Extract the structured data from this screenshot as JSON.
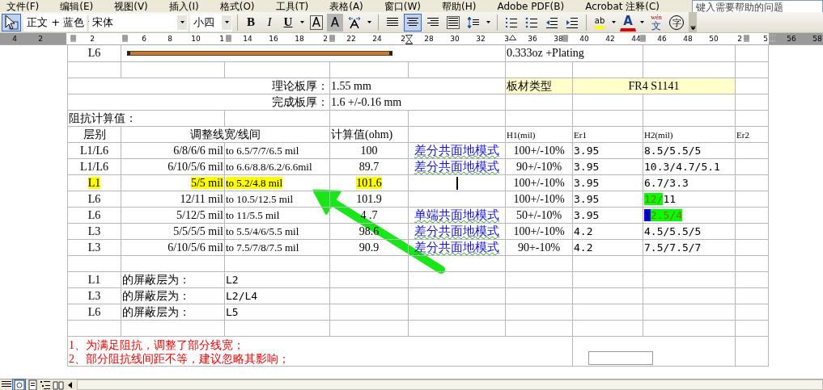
{
  "menu_bar": [
    "文件(F)",
    "编辑(E)",
    "视图(V)",
    "插入(I)",
    "格式(O)",
    "工具(T)",
    "表格(A)",
    "窗口(W)",
    "帮助(H)",
    "Adobe PDF(B)",
    "Acrobat 注释(C)"
  ],
  "help_search": {
    "placeholder": "键入需要帮助的问题"
  },
  "toolbar": {
    "style": "正文 + 蓝色",
    "font": "宋体",
    "size": "小四",
    "buttons": [
      {
        "kind": "styles-pane",
        "selected": true
      },
      {
        "kind": "style-box"
      },
      {
        "kind": "font-box"
      },
      {
        "kind": "size-box"
      },
      {
        "kind": "sep"
      },
      {
        "kind": "bold",
        "label": "B",
        "selected": false
      },
      {
        "kind": "italic",
        "label": "I",
        "selected": false
      },
      {
        "kind": "underline",
        "label": "U",
        "selected": false
      },
      {
        "kind": "border-char",
        "label": "A",
        "selected": false
      },
      {
        "kind": "shade-char",
        "label": "A",
        "selected": false
      },
      {
        "kind": "char-scale",
        "selected": false
      },
      {
        "kind": "sep"
      },
      {
        "kind": "justify",
        "selected": false
      },
      {
        "kind": "center",
        "selected": true
      },
      {
        "kind": "right",
        "selected": false
      },
      {
        "kind": "distribute",
        "selected": false
      },
      {
        "kind": "line-spacing",
        "selected": false
      },
      {
        "kind": "sep"
      },
      {
        "kind": "numbering",
        "selected": false
      },
      {
        "kind": "bullets",
        "selected": false
      },
      {
        "kind": "outdent",
        "selected": false
      },
      {
        "kind": "indent",
        "selected": false
      },
      {
        "kind": "sep"
      },
      {
        "kind": "highlight",
        "label": "ab",
        "selected": false
      },
      {
        "kind": "font-color",
        "label": "A",
        "selected": false
      },
      {
        "kind": "phonetic",
        "label": "文",
        "ruby": "wén",
        "selected": false
      },
      {
        "kind": "enclose",
        "label": "字",
        "selected": false
      },
      {
        "kind": "options"
      }
    ]
  },
  "ruler": [
    {
      "label": "4",
      "kind": "number"
    },
    {
      "label": "2",
      "kind": "number"
    },
    {
      "kind": "column"
    },
    {
      "label": "2",
      "kind": "number"
    },
    {
      "kind": "column"
    },
    {
      "label": "6",
      "kind": "number"
    },
    {
      "label": "8",
      "kind": "number"
    },
    {
      "label": "10",
      "kind": "number"
    },
    {
      "label": "1",
      "kind": "column"
    },
    {
      "label": "14",
      "kind": "number"
    },
    {
      "label": "16",
      "kind": "number"
    },
    {
      "label": "18",
      "kind": "number"
    },
    {
      "label": "2",
      "kind": "column"
    },
    {
      "label": "22",
      "kind": "number"
    },
    {
      "label": "24",
      "kind": "number"
    },
    {
      "label": "2",
      "kind": "indent"
    },
    {
      "label": "28",
      "kind": "number"
    },
    {
      "label": "30",
      "kind": "number"
    },
    {
      "label": "32",
      "kind": "number"
    },
    {
      "label": "3",
      "kind": "tab"
    },
    {
      "label": "36",
      "kind": "number"
    },
    {
      "label": "38",
      "kind": "column"
    },
    {
      "label": "40",
      "kind": "number"
    },
    {
      "label": "42",
      "kind": "number"
    },
    {
      "label": "44",
      "kind": "column"
    },
    {
      "label": "46",
      "kind": "number"
    },
    {
      "label": "48",
      "kind": "number"
    },
    {
      "label": "50",
      "kind": "number"
    },
    {
      "label": "2",
      "kind": "column"
    },
    {
      "label": "5",
      "kind": "column"
    },
    {
      "label": "56",
      "kind": "number"
    },
    {
      "label": "58",
      "kind": "number"
    }
  ],
  "table": {
    "rows": [
      {
        "kind": "trace",
        "cells": [
          {
            "text": "L6",
            "kind": "c"
          },
          {
            "kind": "trace",
            "colspan": 4
          },
          {
            "text": "0.333oz +Plating",
            "kind": "l",
            "colspan": 2
          },
          {},
          {}
        ]
      },
      {
        "kind": "blank",
        "cells": [
          {},
          {},
          {},
          {},
          {},
          {},
          {},
          {},
          {}
        ]
      },
      {
        "kind": "thickness-material",
        "cells": [
          {
            "text": "理论板厚：",
            "kind": "r",
            "colspan": 3
          },
          {
            "text": "1.55 mm",
            "kind": "l",
            "colspan": 2
          },
          {
            "text": "板材类型",
            "kind": "l",
            "shaded": true
          },
          {
            "text": "FR4 S1141",
            "kind": "c",
            "shaded": true,
            "colspan": 2
          },
          {}
        ]
      },
      {
        "kind": "thickness",
        "cells": [
          {
            "text": "完成板厚：",
            "kind": "r",
            "colspan": 3
          },
          {
            "text": "1.6 +/-0.16 mm",
            "kind": "l",
            "colspan": 2
          },
          {},
          {},
          {},
          {}
        ]
      },
      {
        "kind": "section",
        "cells": [
          {
            "text": "阻抗计算值：",
            "kind": "l",
            "colspan": 2
          },
          {},
          {},
          {},
          {},
          {},
          {},
          {}
        ]
      },
      {
        "kind": "header",
        "cells": [
          {
            "text": "层别",
            "kind": "c"
          },
          {
            "text": "调整线宽/线间",
            "kind": "c",
            "colspan": 2
          },
          {
            "text": "计算值(ohm)",
            "kind": "l"
          },
          {},
          {
            "text": "H1(mil)",
            "kind": "s"
          },
          {
            "text": "Er1",
            "kind": "s"
          },
          {
            "text": "H2(mil)",
            "kind": "s"
          },
          {
            "text": "Er2",
            "kind": "s"
          }
        ]
      },
      {
        "kind": "data",
        "cells": [
          {
            "text": "L1/L6",
            "kind": "c"
          },
          {
            "text": "6/8/6/6 mil",
            "kind": "r"
          },
          {
            "text": "to 6.5/7/7/6.5 mil",
            "kind": "w"
          },
          {
            "text": "100",
            "kind": "c"
          },
          {
            "text": "差分共面地模式",
            "kind": "mode"
          },
          {
            "text": "100+/-10%",
            "kind": "c"
          },
          {
            "text": "3.95",
            "kind": "n"
          },
          {
            "text": "8.5/5.5/5",
            "kind": "n"
          },
          {}
        ]
      },
      {
        "kind": "data",
        "cells": [
          {
            "text": "L1/L6",
            "kind": "c"
          },
          {
            "text": "6/10/5/6 mil",
            "kind": "r"
          },
          {
            "text": "to 6.6/8.8/6.2/6.6mil",
            "kind": "w"
          },
          {
            "text": "89.7",
            "kind": "c"
          },
          {
            "text": "差分共面地模式",
            "kind": "mode"
          },
          {
            "text": "90+/-10%",
            "kind": "c"
          },
          {
            "text": "3.95",
            "kind": "n"
          },
          {
            "text": "10.3/4.7/5.1",
            "kind": "n"
          },
          {}
        ]
      },
      {
        "kind": "data",
        "cells": [
          {
            "text": "L1",
            "kind": "c",
            "highlighted": true
          },
          {
            "text": "5/5 mil",
            "kind": "r",
            "highlighted": true
          },
          {
            "text": "to 5.2/4.8 mil",
            "kind": "w",
            "highlighted": true
          },
          {
            "text": "101.6",
            "kind": "c",
            "highlighted": true
          },
          {
            "kind": "caret"
          },
          {
            "text": "100+/-10%",
            "kind": "c"
          },
          {
            "text": "3.95",
            "kind": "n"
          },
          {
            "text": "6.7/3.3",
            "kind": "n"
          },
          {}
        ]
      },
      {
        "kind": "data",
        "cells": [
          {
            "text": "L6",
            "kind": "c"
          },
          {
            "text": "12/11 mil",
            "kind": "r"
          },
          {
            "text": "to 10.5/12.5 mil",
            "kind": "w"
          },
          {
            "text": "101.9",
            "kind": "c"
          },
          {},
          {
            "text": "100+/-10%",
            "kind": "c"
          },
          {
            "text": "3.95",
            "kind": "n"
          },
          {
            "kind": "segments",
            "segments": [
              {
                "text": "12/",
                "color": "#00ff00"
              },
              {
                "text": "11"
              }
            ]
          },
          {}
        ]
      },
      {
        "kind": "data",
        "cells": [
          {
            "text": "L6",
            "kind": "c"
          },
          {
            "text": "5/12/5 mil",
            "kind": "r"
          },
          {
            "text": "to 11/5.5 mil",
            "kind": "w"
          },
          {
            "text": "4 .7",
            "kind": "c"
          },
          {
            "text": "单端共面地模式",
            "kind": "mode"
          },
          {
            "text": "50+/-10%",
            "kind": "c"
          },
          {
            "text": "3.95",
            "kind": "n"
          },
          {
            "kind": "segments",
            "segments": [
              {
                "text": "1",
                "color": "#0000ff"
              },
              {
                "text": "2.5/4",
                "color": "#00ff00"
              }
            ]
          },
          {}
        ]
      },
      {
        "kind": "data",
        "cells": [
          {
            "text": "L3",
            "kind": "c"
          },
          {
            "text": "5/5/5/5 mil",
            "kind": "r"
          },
          {
            "text": "to 5.5/4/6/5.5 mil",
            "kind": "w"
          },
          {
            "text": "98.6",
            "kind": "c"
          },
          {
            "text": "差分共面地模式",
            "kind": "mode"
          },
          {
            "text": "100+/-10%",
            "kind": "c"
          },
          {
            "text": "4.2",
            "kind": "n"
          },
          {
            "text": "4.5/5.5/5",
            "kind": "n"
          },
          {}
        ]
      },
      {
        "kind": "data",
        "cells": [
          {
            "text": "L3",
            "kind": "c"
          },
          {
            "text": "6/10/5/6 mil",
            "kind": "r"
          },
          {
            "text": "to 7.5/7/8/7.5 mil",
            "kind": "w"
          },
          {
            "text": "90.9",
            "kind": "c"
          },
          {
            "text": "差分共面地模式",
            "kind": "mode"
          },
          {
            "text": "90+-10%",
            "kind": "c"
          },
          {
            "text": "4.2",
            "kind": "n"
          },
          {
            "text": "7.5/7.5/7",
            "kind": "n"
          },
          {}
        ]
      },
      {
        "kind": "blank",
        "cells": [
          {},
          {},
          {},
          {},
          {},
          {},
          {},
          {},
          {}
        ]
      },
      {
        "kind": "shield",
        "cells": [
          {
            "text": "L1",
            "kind": "c"
          },
          {
            "text": "的屏蔽层为：",
            "kind": "l"
          },
          {
            "text": "L2",
            "kind": "n"
          },
          {},
          {},
          {},
          {},
          {},
          {}
        ]
      },
      {
        "kind": "shield",
        "cells": [
          {
            "text": "L3",
            "kind": "c"
          },
          {
            "text": "的屏蔽层为：",
            "kind": "l"
          },
          {
            "text": "L2/L4",
            "kind": "n"
          },
          {},
          {},
          {},
          {},
          {},
          {}
        ]
      },
      {
        "kind": "shield",
        "cells": [
          {
            "text": "L6",
            "kind": "c"
          },
          {
            "text": "的屏蔽层为：",
            "kind": "l"
          },
          {
            "text": "L5",
            "kind": "n"
          },
          {},
          {},
          {},
          {},
          {},
          {}
        ]
      },
      {
        "kind": "blank",
        "cells": [
          {},
          {},
          {},
          {},
          {},
          {},
          {},
          {},
          {}
        ]
      },
      {
        "kind": "notes",
        "cells": [
          {
            "kind": "note",
            "colspan": 6,
            "lines": [
              "1、为满足阻抗，调整了部分线宽；",
              "2、部分阻抗线间距不等，建议忽略其影响；"
            ]
          },
          {
            "kind": "box",
            "colspan": 2
          },
          {}
        ]
      }
    ]
  }
}
